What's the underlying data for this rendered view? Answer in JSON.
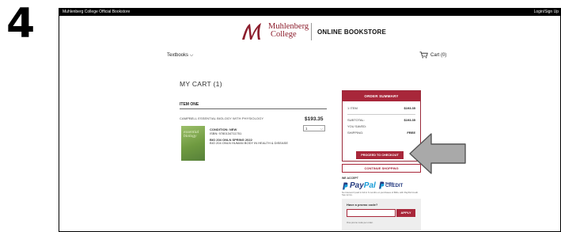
{
  "step_number": "4",
  "topbar": {
    "store_name": "Muhlenberg College Official Bookstore",
    "login_link": "Login/Sign Up"
  },
  "header": {
    "logo_line1": "Muhlenberg",
    "logo_line2": "College",
    "title": "ONLINE BOOKSTORE",
    "logo_color": "#8c1d2c"
  },
  "nav": {
    "textbooks_label": "Textbooks",
    "cart_label": "Cart (0)"
  },
  "cart": {
    "title": "MY CART (1)",
    "item_heading": "ITEM ONE",
    "item": {
      "title": "CAMPBELL ESSENTIAL BIOLOGY WITH PHYSIOLOGY",
      "price": "$193.35",
      "quantity": "1",
      "condition": "CONDITION: NEW",
      "isbn": "ISBN: 9780134711751",
      "course_line1": "BIO 204 ONLN SPRING 2022",
      "course_line2": "BIO 204 ONLN HUMAN BODY IN HEALTH & DISEASE",
      "cover_text_1": "essential",
      "cover_text_2": "biology"
    }
  },
  "summary": {
    "header": "ORDER SUMMARY",
    "items_label": "1 ITEM",
    "items_value": "$193.35",
    "subtotal_label": "SUBTOTAL:",
    "subtotal_value": "$193.35",
    "saved_label": "YOU SAVED:",
    "shipping_label": "SHIPPING:",
    "shipping_value": "FREE",
    "checkout_label": "PROCEED TO CHECKOUT",
    "accent_color": "#a8273a"
  },
  "continue_label": "CONTINUE SHOPPING",
  "payment": {
    "we_accept": "WE ACCEPT",
    "paypal_pay": "Pay",
    "paypal_pal": "Pal",
    "credit_line1": "PayPal",
    "credit_line2": "CREDIT",
    "fine_print": "No Interest if paid in full in 6 months on purchases of $99+ with PayPal Credit. See terms."
  },
  "promo": {
    "label": "Have a promo code?",
    "input_value": "",
    "apply_label": "APPLY",
    "note": "One promo code per order."
  }
}
